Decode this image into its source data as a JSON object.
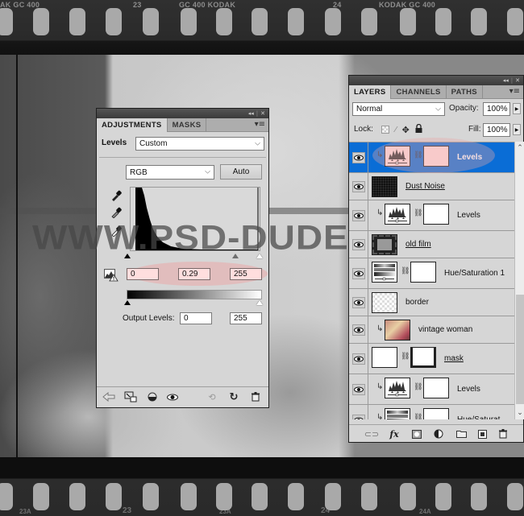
{
  "background": {
    "film_top_labels": [
      "AK GC 400",
      "23",
      "GC 400 KODAK",
      "24",
      "KODAK GC 400"
    ],
    "film_bottom_labels": [
      "23A",
      "23",
      "23A",
      "24",
      "24A"
    ],
    "watermark": "WWW.PSD-DUDE.COM"
  },
  "adjustments_panel": {
    "titlebar": {
      "collapse_icon": "◂◂",
      "close_icon": "✕"
    },
    "tabs": [
      {
        "label": "ADJUSTMENTS",
        "active": true
      },
      {
        "label": "MASKS",
        "active": false
      }
    ],
    "adjustment_type": "Levels",
    "preset": {
      "value": "Custom"
    },
    "channel": {
      "value": "RGB"
    },
    "auto_button": "Auto",
    "input_levels": {
      "black": "0",
      "midtone": "0.29",
      "white": "255"
    },
    "input_sliders": {
      "black": 0,
      "midtone_position": 0.82,
      "white": 255
    },
    "output_label": "Output Levels:",
    "output_levels": {
      "black": "0",
      "white": "255"
    },
    "footer_icons": [
      "back-arrow-icon",
      "expand-view-icon",
      "clip-to-layer-icon",
      "visibility-eye-icon",
      "view-previous-icon",
      "reset-icon",
      "delete-icon"
    ]
  },
  "layers_panel": {
    "titlebar": {
      "collapse_icon": "◂◂",
      "close_icon": "✕"
    },
    "tabs": [
      {
        "label": "LAYERS",
        "active": true
      },
      {
        "label": "CHANNELS",
        "active": false
      },
      {
        "label": "PATHS",
        "active": false
      }
    ],
    "blend_mode": "Normal",
    "opacity_label": "Opacity:",
    "opacity": "100%",
    "lock_label": "Lock:",
    "fill_label": "Fill:",
    "fill": "100%",
    "layers": [
      {
        "name": "Levels",
        "type": "levels",
        "clipped": true,
        "selected": true,
        "underlined": false
      },
      {
        "name": "Dust Noise",
        "type": "noise",
        "clipped": false,
        "selected": false,
        "underlined": true
      },
      {
        "name": "Levels",
        "type": "levels",
        "clipped": true,
        "selected": false,
        "underlined": false
      },
      {
        "name": "old film",
        "type": "film",
        "clipped": false,
        "selected": false,
        "underlined": true
      },
      {
        "name": "Hue/Saturation 1",
        "type": "huesat",
        "clipped": false,
        "selected": false,
        "underlined": false
      },
      {
        "name": "border",
        "type": "transparent",
        "clipped": false,
        "selected": false,
        "underlined": false
      },
      {
        "name": "vintage woman",
        "type": "photo",
        "clipped": true,
        "selected": false,
        "underlined": false
      },
      {
        "name": "mask",
        "type": "masked",
        "clipped": false,
        "selected": false,
        "underlined": true
      },
      {
        "name": "Levels",
        "type": "levels",
        "clipped": true,
        "selected": false,
        "underlined": false
      },
      {
        "name": "Hue/Saturat...",
        "type": "huesat",
        "clipped": true,
        "selected": false,
        "underlined": false
      }
    ],
    "footer_icons": [
      "link-layers-icon",
      "fx-icon",
      "add-mask-icon",
      "new-adjustment-icon",
      "new-group-icon",
      "new-layer-icon",
      "delete-layer-icon"
    ]
  },
  "colors": {
    "selection_blue": "#0a6dd6",
    "highlight_pink": "#ffdede",
    "panel_gray": "#d6d6d6"
  }
}
